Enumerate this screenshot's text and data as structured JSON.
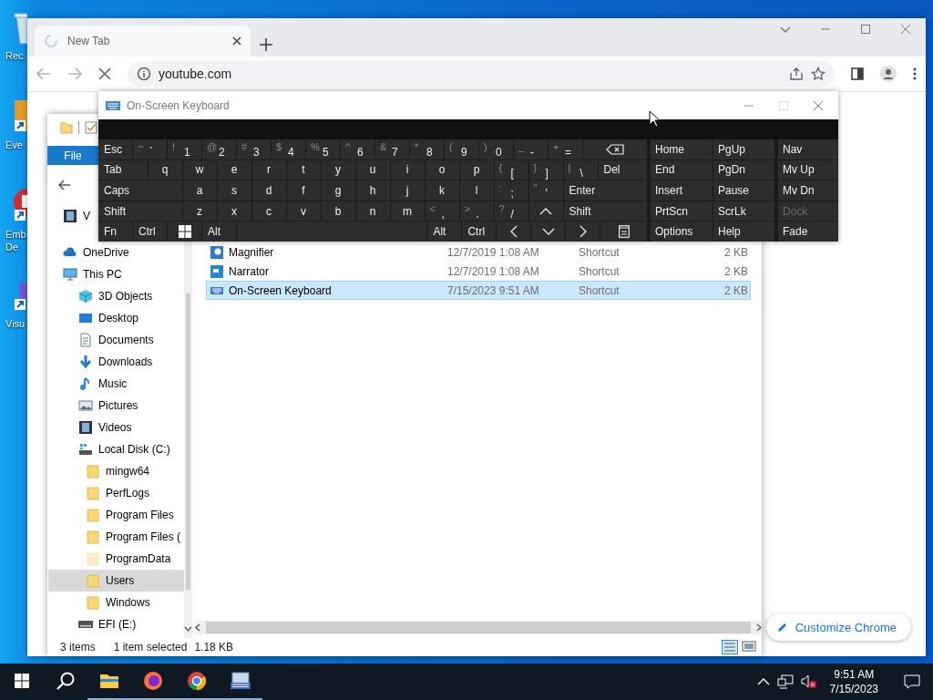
{
  "desktop": {
    "icons": [
      {
        "kind": "recycle",
        "label": "Rec"
      },
      {
        "kind": "shortcut",
        "label": "Eve"
      },
      {
        "kind": "red-app",
        "label": "Emb De"
      },
      {
        "kind": "purple-app",
        "label": "Visu"
      }
    ]
  },
  "browser": {
    "tab": {
      "title": "New Tab",
      "loading": true
    },
    "address": "youtube.com",
    "customize_button": "Customize Chrome"
  },
  "explorer": {
    "ribbon_tabs": [
      {
        "label": "File",
        "selected": true
      }
    ],
    "nav_items": [
      {
        "kind": "videos",
        "label": "V",
        "selected": false
      },
      {
        "kind": "onedrive",
        "label": "OneDrive",
        "selected": false
      },
      {
        "kind": "pc",
        "label": "This PC",
        "selected": false,
        "children": [
          {
            "kind": "objects3d",
            "label": "3D Objects",
            "selected": false
          },
          {
            "kind": "desktop",
            "label": "Desktop",
            "selected": false
          },
          {
            "kind": "documents",
            "label": "Documents",
            "selected": false
          },
          {
            "kind": "downloads",
            "label": "Downloads",
            "selected": false
          },
          {
            "kind": "music",
            "label": "Music",
            "selected": false
          },
          {
            "kind": "pictures",
            "label": "Pictures",
            "selected": false
          },
          {
            "kind": "videos",
            "label": "Videos",
            "selected": false
          },
          {
            "kind": "disk",
            "label": "Local Disk (C:)",
            "selected": false,
            "children": [
              {
                "kind": "folder",
                "label": "mingw64",
                "selected": false,
                "hidden": false
              },
              {
                "kind": "folder",
                "label": "PerfLogs",
                "selected": false,
                "hidden": false
              },
              {
                "kind": "folder",
                "label": "Program Files",
                "selected": false,
                "hidden": false
              },
              {
                "kind": "folder",
                "label": "Program Files (",
                "selected": false,
                "hidden": false
              },
              {
                "kind": "folder",
                "label": "ProgramData",
                "selected": false,
                "hidden": true
              },
              {
                "kind": "folder",
                "label": "Users",
                "selected": true,
                "hidden": false
              },
              {
                "kind": "folder",
                "label": "Windows",
                "selected": false,
                "hidden": false
              }
            ]
          },
          {
            "kind": "drive",
            "label": "EFI (E:)",
            "selected": false
          }
        ]
      }
    ],
    "files": [
      {
        "kind": "magnifier",
        "name": "Magnifier",
        "date": "12/7/2019 1:08 AM",
        "type": "Shortcut",
        "size": "2 KB",
        "selected": false
      },
      {
        "kind": "narrator",
        "name": "Narrator",
        "date": "12/7/2019 1:08 AM",
        "type": "Shortcut",
        "size": "2 KB",
        "selected": false
      },
      {
        "kind": "keyboard",
        "name": "On-Screen Keyboard",
        "date": "7/15/2023 9:51 AM",
        "type": "Shortcut",
        "size": "2 KB",
        "selected": true
      }
    ],
    "status_bar": {
      "count": "3 items",
      "selection": "1 item selected",
      "size": "1.18 KB"
    }
  },
  "keyboard": {
    "title": "On-Screen Keyboard",
    "key_rows": [
      {
        "keys": [
          {
            "kind": "key",
            "label": "Esc"
          },
          {
            "kind": "dual",
            "shift": "~",
            "label": "`"
          },
          {
            "kind": "dual",
            "shift": "!",
            "label": "1"
          },
          {
            "kind": "dual",
            "shift": "@",
            "label": "2"
          },
          {
            "kind": "dual",
            "shift": "#",
            "label": "3"
          },
          {
            "kind": "dual",
            "shift": "$",
            "label": "4"
          },
          {
            "kind": "dual",
            "shift": "%",
            "label": "5"
          },
          {
            "kind": "dual",
            "shift": "^",
            "label": "6"
          },
          {
            "kind": "dual",
            "shift": "&",
            "label": "7"
          },
          {
            "kind": "dual",
            "shift": "*",
            "label": "8"
          },
          {
            "kind": "dual",
            "shift": "(",
            "label": "9"
          },
          {
            "kind": "dual",
            "shift": ")",
            "label": "0"
          },
          {
            "kind": "dual",
            "shift": "_",
            "label": "-"
          },
          {
            "kind": "dual",
            "shift": "+",
            "label": "="
          },
          {
            "kind": "backspace"
          }
        ]
      },
      {
        "keys": [
          {
            "kind": "wide",
            "label": "Tab"
          },
          {
            "kind": "letter",
            "label": "q"
          },
          {
            "kind": "letter",
            "label": "w"
          },
          {
            "kind": "letter",
            "label": "e"
          },
          {
            "kind": "letter",
            "label": "r"
          },
          {
            "kind": "letter",
            "label": "t"
          },
          {
            "kind": "letter",
            "label": "y"
          },
          {
            "kind": "letter",
            "label": "u"
          },
          {
            "kind": "letter",
            "label": "i"
          },
          {
            "kind": "letter",
            "label": "o"
          },
          {
            "kind": "letter",
            "label": "p"
          },
          {
            "kind": "dual",
            "shift": "{",
            "label": "["
          },
          {
            "kind": "dual",
            "shift": "}",
            "label": "]"
          },
          {
            "kind": "dual",
            "shift": "|",
            "label": "\\"
          },
          {
            "kind": "wide",
            "label": "Del"
          }
        ]
      },
      {
        "keys": [
          {
            "kind": "wide",
            "label": "Caps"
          },
          {
            "kind": "letter",
            "label": "a"
          },
          {
            "kind": "letter",
            "label": "s"
          },
          {
            "kind": "letter",
            "label": "d"
          },
          {
            "kind": "letter",
            "label": "f"
          },
          {
            "kind": "letter",
            "label": "g"
          },
          {
            "kind": "letter",
            "label": "h"
          },
          {
            "kind": "letter",
            "label": "j"
          },
          {
            "kind": "letter",
            "label": "k"
          },
          {
            "kind": "letter",
            "label": "l"
          },
          {
            "kind": "dual",
            "shift": ":",
            "label": ";"
          },
          {
            "kind": "dual",
            "shift": "\"",
            "label": "'"
          },
          {
            "kind": "wide",
            "label": "Enter"
          }
        ]
      },
      {
        "keys": [
          {
            "kind": "wide",
            "label": "Shift"
          },
          {
            "kind": "letter",
            "label": "z"
          },
          {
            "kind": "letter",
            "label": "x"
          },
          {
            "kind": "letter",
            "label": "c"
          },
          {
            "kind": "letter",
            "label": "v"
          },
          {
            "kind": "letter",
            "label": "b"
          },
          {
            "kind": "letter",
            "label": "n"
          },
          {
            "kind": "letter",
            "label": "m"
          },
          {
            "kind": "dual",
            "shift": "<",
            "label": ","
          },
          {
            "kind": "dual",
            "shift": ">",
            "label": "."
          },
          {
            "kind": "dual",
            "shift": "?",
            "label": "/"
          },
          {
            "kind": "up"
          },
          {
            "kind": "wide",
            "label": "Shift"
          }
        ]
      },
      {
        "keys": [
          {
            "kind": "key",
            "label": "Fn"
          },
          {
            "kind": "key",
            "label": "Ctrl"
          },
          {
            "kind": "windows"
          },
          {
            "kind": "key",
            "label": "Alt"
          },
          {
            "kind": "space"
          },
          {
            "kind": "key",
            "label": "Alt"
          },
          {
            "kind": "key",
            "label": "Ctrl"
          },
          {
            "kind": "left"
          },
          {
            "kind": "down"
          },
          {
            "kind": "right"
          },
          {
            "kind": "menu"
          }
        ]
      }
    ],
    "nav_keys": [
      [
        {
          "label": "Home",
          "disabled": false
        },
        {
          "label": "PgUp",
          "disabled": false
        },
        {
          "label": "Nav",
          "disabled": false
        }
      ],
      [
        {
          "label": "End",
          "disabled": false
        },
        {
          "label": "PgDn",
          "disabled": false
        },
        {
          "label": "Mv Up",
          "disabled": false
        }
      ],
      [
        {
          "label": "Insert",
          "disabled": false
        },
        {
          "label": "Pause",
          "disabled": false
        },
        {
          "label": "Mv Dn",
          "disabled": false
        }
      ],
      [
        {
          "label": "PrtScn",
          "disabled": false
        },
        {
          "label": "ScrLk",
          "disabled": false
        },
        {
          "label": "Dock",
          "disabled": true
        }
      ],
      [
        {
          "label": "Options",
          "disabled": false
        },
        {
          "label": "Help",
          "disabled": false
        },
        {
          "label": "Fade",
          "disabled": false
        }
      ]
    ]
  },
  "taskbar": {
    "apps": [
      {
        "kind": "explorer",
        "running": true
      },
      {
        "kind": "firefox",
        "running": true
      },
      {
        "kind": "chrome",
        "running": true
      },
      {
        "kind": "keyboard",
        "running": true
      }
    ],
    "clock": {
      "time": "9:51 AM",
      "date": "7/15/2023"
    }
  }
}
